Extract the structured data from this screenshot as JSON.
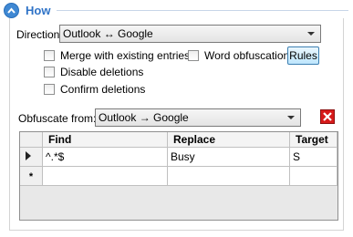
{
  "section": {
    "title": "How"
  },
  "direction": {
    "label": "Direction:",
    "value": "Outlook ↔ Google"
  },
  "options": {
    "merge": {
      "label": "Merge with existing entries",
      "checked": false
    },
    "disable_deletions": {
      "label": "Disable deletions",
      "checked": false
    },
    "confirm_deletions": {
      "label": "Confirm deletions",
      "checked": false
    },
    "word_obfuscation": {
      "label": "Word obfuscation",
      "checked": false
    }
  },
  "rules_button": {
    "label": "Rules"
  },
  "obfuscate": {
    "label": "Obfuscate from:",
    "value": "Outlook → Google"
  },
  "grid": {
    "columns": [
      "Find",
      "Replace",
      "Target"
    ],
    "rows": [
      {
        "find": "^.*$",
        "replace": "Busy",
        "target": "S"
      }
    ],
    "current_row_marker": "▶",
    "new_row_marker": "*"
  },
  "colors": {
    "accent": "#2f73c7",
    "delete_red": "#d71a1a"
  }
}
